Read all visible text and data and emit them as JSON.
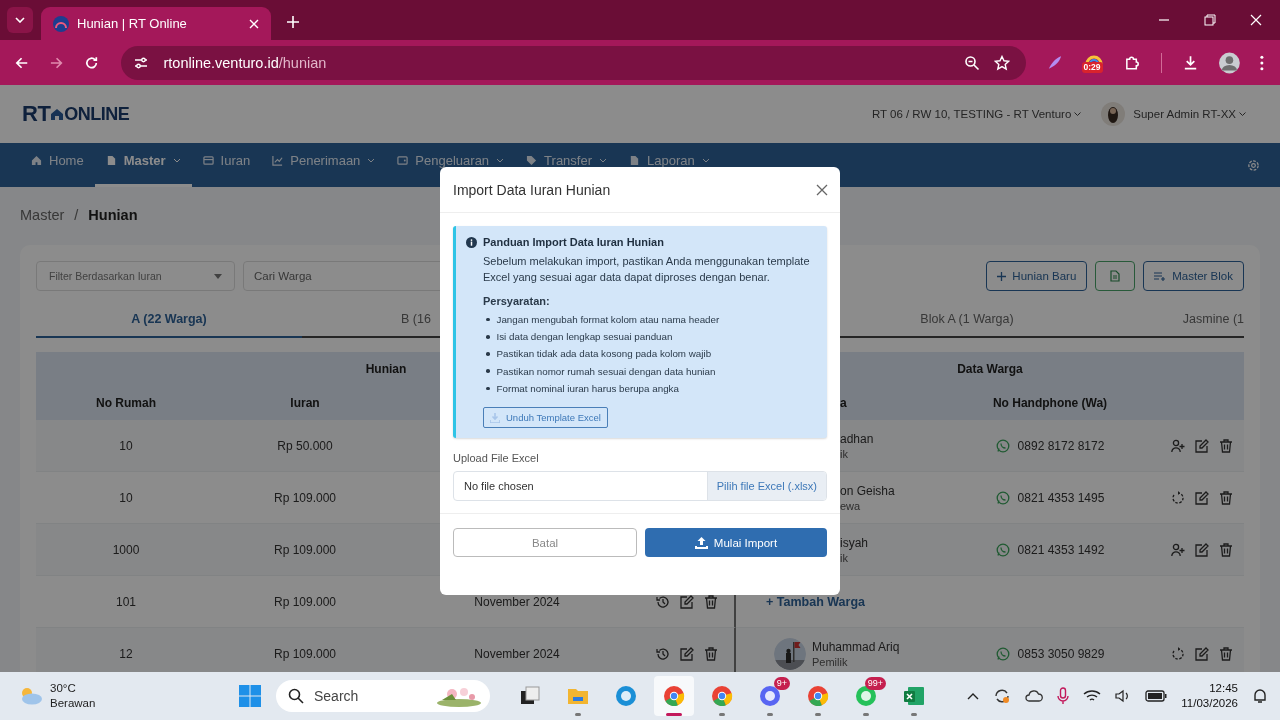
{
  "browser": {
    "tab_title": "Hunian | RT Online",
    "url_host": "rtonline.venturo.id",
    "url_path": "/hunian",
    "extension_badge": "0:29"
  },
  "header": {
    "logo_left": "RT",
    "logo_right": "ONLINE",
    "location": "RT 06 / RW 10, TESTING - RT Venturo",
    "user": "Super Admin RT-XX"
  },
  "nav": [
    {
      "label": "Home",
      "kind": "home",
      "selected": false,
      "dropdown": false
    },
    {
      "label": "Master",
      "kind": "file",
      "selected": true,
      "dropdown": true
    },
    {
      "label": "Iuran",
      "kind": "card",
      "selected": false,
      "dropdown": false
    },
    {
      "label": "Penerimaan",
      "kind": "chart",
      "selected": false,
      "dropdown": true
    },
    {
      "label": "Pengeluaran",
      "kind": "wallet",
      "selected": false,
      "dropdown": true
    },
    {
      "label": "Transfer",
      "kind": "tag",
      "selected": false,
      "dropdown": true
    },
    {
      "label": "Laporan",
      "kind": "file",
      "selected": false,
      "dropdown": true
    }
  ],
  "breadcrumb": {
    "parent": "Master",
    "separator": "/",
    "current": "Hunian"
  },
  "toolbar": {
    "filter_placeholder": "Filter Berdasarkan Iuran",
    "search_placeholder": "Cari Warga",
    "buttons": [
      {
        "kind": "add",
        "label": "Hunian Baru"
      },
      {
        "kind": "excel"
      },
      {
        "kind": "blocks",
        "label": "Master Blok"
      }
    ]
  },
  "tabs": [
    {
      "label": "A (22 Warga)",
      "selected": true
    },
    {
      "label": "B (16",
      "selected": false
    },
    {
      "label": "Blok A (1 Warga)",
      "selected": false
    },
    {
      "label": "Jasmine (1",
      "selected": false
    }
  ],
  "table": {
    "group_headers": [
      "Hunian",
      "Data Warga"
    ],
    "columns": [
      "No Rumah",
      "Iuran",
      "a",
      "No Handphone (Wa)"
    ],
    "rows": [
      {
        "kind": "partial",
        "no_rumah": "10",
        "iuran": "Rp 50.000",
        "name": "adhan",
        "role": "ik",
        "phone": "0892 8172 8172",
        "actions": [
          {
            "kind": "add-person"
          },
          {
            "kind": "edit"
          },
          {
            "kind": "delete"
          }
        ]
      },
      {
        "kind": "partial",
        "no_rumah": "10",
        "iuran": "Rp 109.000",
        "name": "on Geisha",
        "role": "ewa",
        "phone": "0821 4353 1495",
        "actions": [
          {
            "kind": "restore"
          },
          {
            "kind": "edit"
          },
          {
            "kind": "delete"
          }
        ]
      },
      {
        "kind": "partial",
        "no_rumah": "1000",
        "iuran": "Rp 109.000",
        "name": "isyah",
        "role": "ik",
        "phone": "0821 4353 1492",
        "actions": [
          {
            "kind": "add-person"
          },
          {
            "kind": "edit"
          },
          {
            "kind": "delete"
          }
        ]
      },
      {
        "kind": "add-resident",
        "no_rumah": "101",
        "iuran": "Rp 109.000",
        "period": "November 2024",
        "left_actions": [
          {
            "kind": "history"
          },
          {
            "kind": "edit"
          },
          {
            "kind": "delete"
          }
        ],
        "add_label": "+ Tambah Warga"
      },
      {
        "kind": "resident",
        "no_rumah": "12",
        "iuran": "Rp 109.000",
        "period": "November 2024",
        "left_actions": [
          {
            "kind": "history"
          },
          {
            "kind": "edit"
          },
          {
            "kind": "delete"
          }
        ],
        "name": "Muhammad Ariq",
        "role": "Pemilik",
        "phone": "0853 3050 9829",
        "actions": [
          {
            "kind": "restore"
          },
          {
            "kind": "edit"
          },
          {
            "kind": "delete"
          }
        ]
      }
    ]
  },
  "modal": {
    "title": "Import Data Iuran Hunian",
    "guide_title": "Panduan Import Data Iuran Hunian",
    "guide_text": "Sebelum melakukan import, pastikan Anda menggunakan template Excel yang sesuai agar data dapat diproses dengan benar.",
    "requirements_title": "Persyaratan:",
    "requirements": [
      "Jangan mengubah format kolom atau nama header",
      "Isi data dengan lengkap sesuai panduan",
      "Pastikan tidak ada data kosong pada kolom wajib",
      "Pastikan nomor rumah sesuai dengan data hunian",
      "Format nominal iuran harus berupa angka"
    ],
    "download_button": "Unduh Template Excel",
    "upload_label": "Upload File Excel",
    "file_value": "No file chosen",
    "file_button": "Pilih file Excel (.xlsx)",
    "cancel_button": "Batal",
    "submit_button": "Mulai Import"
  },
  "taskbar": {
    "temperature": "30°C",
    "weather": "Berawan",
    "search_placeholder": "Search",
    "apps": [
      {
        "kind": "taskview",
        "running": false,
        "selected": false
      },
      {
        "kind": "folder",
        "running": true,
        "selected": false
      },
      {
        "kind": "edge",
        "running": false,
        "selected": false
      },
      {
        "kind": "chrome",
        "running": true,
        "selected": true
      },
      {
        "kind": "chrome",
        "running": true,
        "selected": false
      },
      {
        "kind": "discord",
        "running": true,
        "selected": false,
        "badge": "9+"
      },
      {
        "kind": "chrome",
        "running": true,
        "selected": false
      },
      {
        "kind": "whatsapp",
        "running": true,
        "selected": false,
        "badge": "99+"
      },
      {
        "kind": "excel",
        "running": true,
        "selected": false
      }
    ],
    "time": "12:45",
    "date": "11/03/2026"
  }
}
